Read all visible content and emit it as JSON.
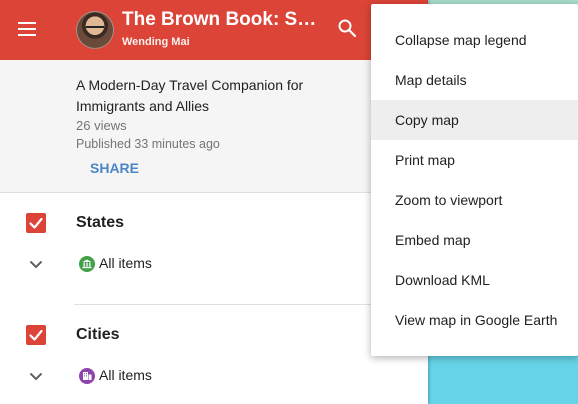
{
  "header": {
    "title": "The Brown Book: San...",
    "author": "Wending Mai",
    "background": "#db4437",
    "icons": [
      "menu-icon",
      "search-icon"
    ]
  },
  "info": {
    "description": "A Modern-Day Travel Companion for Immigrants and Allies",
    "views": "26 views",
    "published": "Published 33 minutes ago",
    "share_label": "SHARE"
  },
  "layers": [
    {
      "name": "States",
      "checked": true,
      "items_label": "All items",
      "icon": "landmark-icon",
      "icon_color": "#43a047"
    },
    {
      "name": "Cities",
      "checked": true,
      "items_label": "All items",
      "icon": "building-icon",
      "icon_color": "#8e44ad"
    }
  ],
  "menu": {
    "items": [
      "Collapse map legend",
      "Map details",
      "Copy map",
      "Print map",
      "Zoom to viewport",
      "Embed map",
      "Download KML",
      "View map in Google Earth"
    ],
    "highlighted": "Copy map"
  },
  "colors": {
    "accent": "#db4437",
    "share": "#4a86c5",
    "map_water": "#66d4e8",
    "map_land": "#a7dcc9"
  }
}
